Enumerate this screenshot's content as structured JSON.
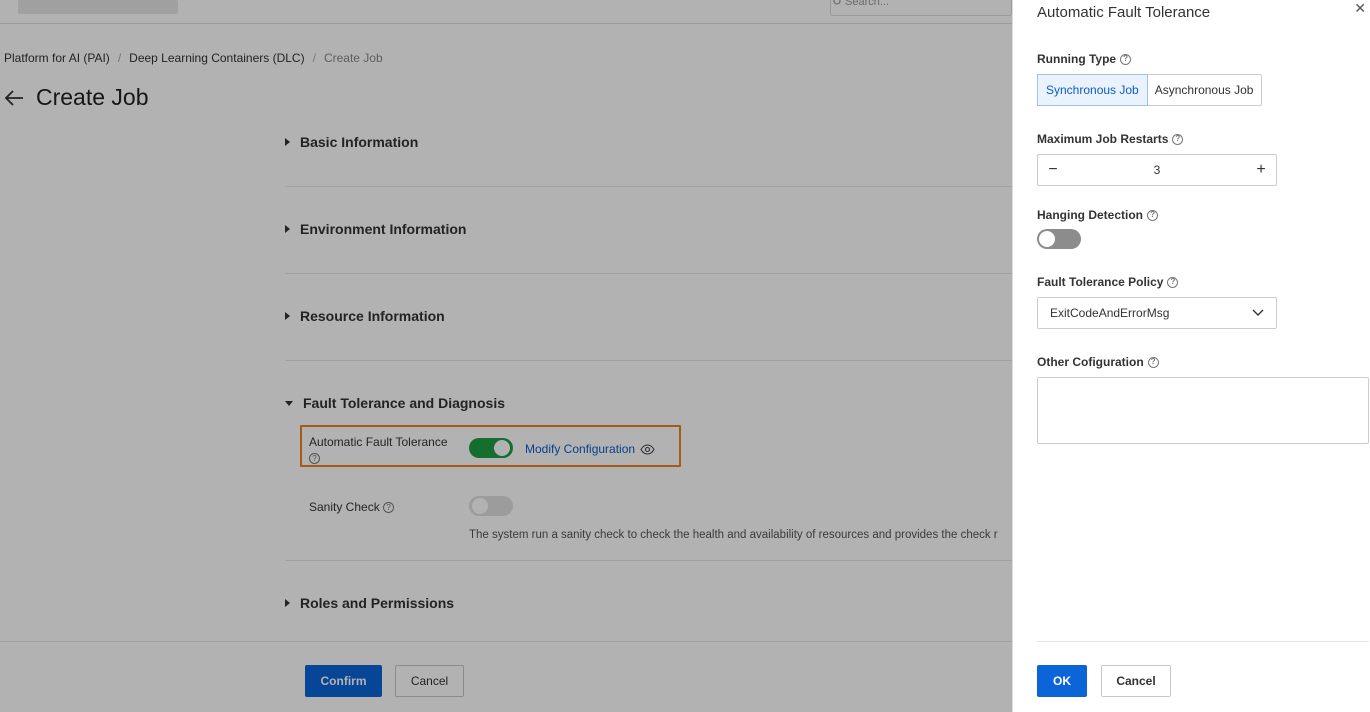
{
  "topbar": {
    "search_placeholder": "Search..."
  },
  "breadcrumb": {
    "items": [
      "Platform for AI (PAI)",
      "Deep Learning Containers (DLC)",
      "Create Job"
    ],
    "separator": "/"
  },
  "page": {
    "back_icon": "arrow-left-icon",
    "title": "Create Job"
  },
  "sections": {
    "basic": "Basic Information",
    "environment": "Environment Information",
    "resource": "Resource Information",
    "fault": "Fault Tolerance and Diagnosis",
    "roles": "Roles and Permissions"
  },
  "fault_tolerance": {
    "auto_label": "Automatic Fault Tolerance",
    "auto_enabled": true,
    "modify_link": "Modify Configuration",
    "modify_icon": "eye-icon",
    "sanity_label": "Sanity Check",
    "sanity_enabled": false,
    "sanity_desc": "The system run a sanity check to check the health and availability of resources and provides the check r"
  },
  "footer": {
    "confirm": "Confirm",
    "cancel": "Cancel"
  },
  "drawer": {
    "title": "Automatic Fault Tolerance",
    "close_icon": "close-icon",
    "running_type": {
      "label": "Running Type",
      "options": [
        "Synchronous Job",
        "Asynchronous Job"
      ],
      "selected": "Synchronous Job"
    },
    "max_restarts": {
      "label": "Maximum Job Restarts",
      "value": "3",
      "minus": "−",
      "plus": "+"
    },
    "hanging_detection": {
      "label": "Hanging Detection",
      "enabled": false
    },
    "policy": {
      "label": "Fault Tolerance Policy",
      "value": "ExitCodeAndErrorMsg"
    },
    "other": {
      "label": "Other Cofiguration",
      "value": ""
    },
    "ok": "OK",
    "cancel": "Cancel"
  },
  "colors": {
    "primary": "#0b64d8",
    "link": "#0b5dc7",
    "switch_on": "#1f9c46",
    "highlight": "#f0821e"
  }
}
